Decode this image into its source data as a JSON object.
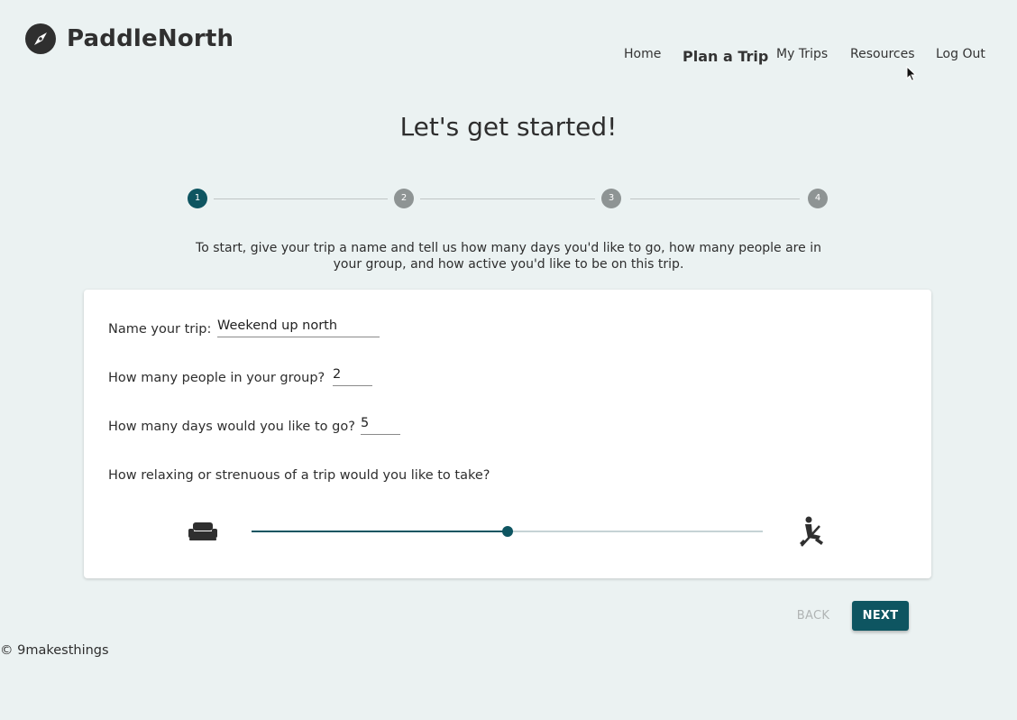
{
  "brand": {
    "name": "PaddleNorth",
    "icon": "compass-icon"
  },
  "nav": {
    "items": [
      {
        "label": "Home"
      },
      {
        "label": "Plan a Trip",
        "active": true
      },
      {
        "label": "My Trips"
      },
      {
        "label": "Resources"
      },
      {
        "label": "Log Out"
      }
    ]
  },
  "page": {
    "title": "Let's get started!",
    "intro": "To start, give your trip a name and tell us how many days you'd like to go, how many people are in your group, and how active you'd like to be on this trip."
  },
  "stepper": {
    "steps": [
      "1",
      "2",
      "3",
      "4"
    ],
    "active_step": 1
  },
  "form": {
    "trip_name": {
      "label": "Name your trip:",
      "value": "Weekend up north"
    },
    "group_size": {
      "label": "How many people in your group?",
      "value": "2"
    },
    "days": {
      "label": "How many days would you like to go?",
      "value": "5"
    },
    "intensity": {
      "label": "How relaxing or strenuous of a trip would you like to take?",
      "value_fraction": 0.5,
      "min_icon": "couch-icon",
      "max_icon": "kayaker-icon"
    }
  },
  "actions": {
    "back_label": "BACK",
    "next_label": "NEXT"
  },
  "footer": {
    "copyright": "© 9makesthings"
  },
  "colors": {
    "accent": "#0e5561",
    "background": "#ebf2f2",
    "step_inactive": "#8e9494"
  }
}
